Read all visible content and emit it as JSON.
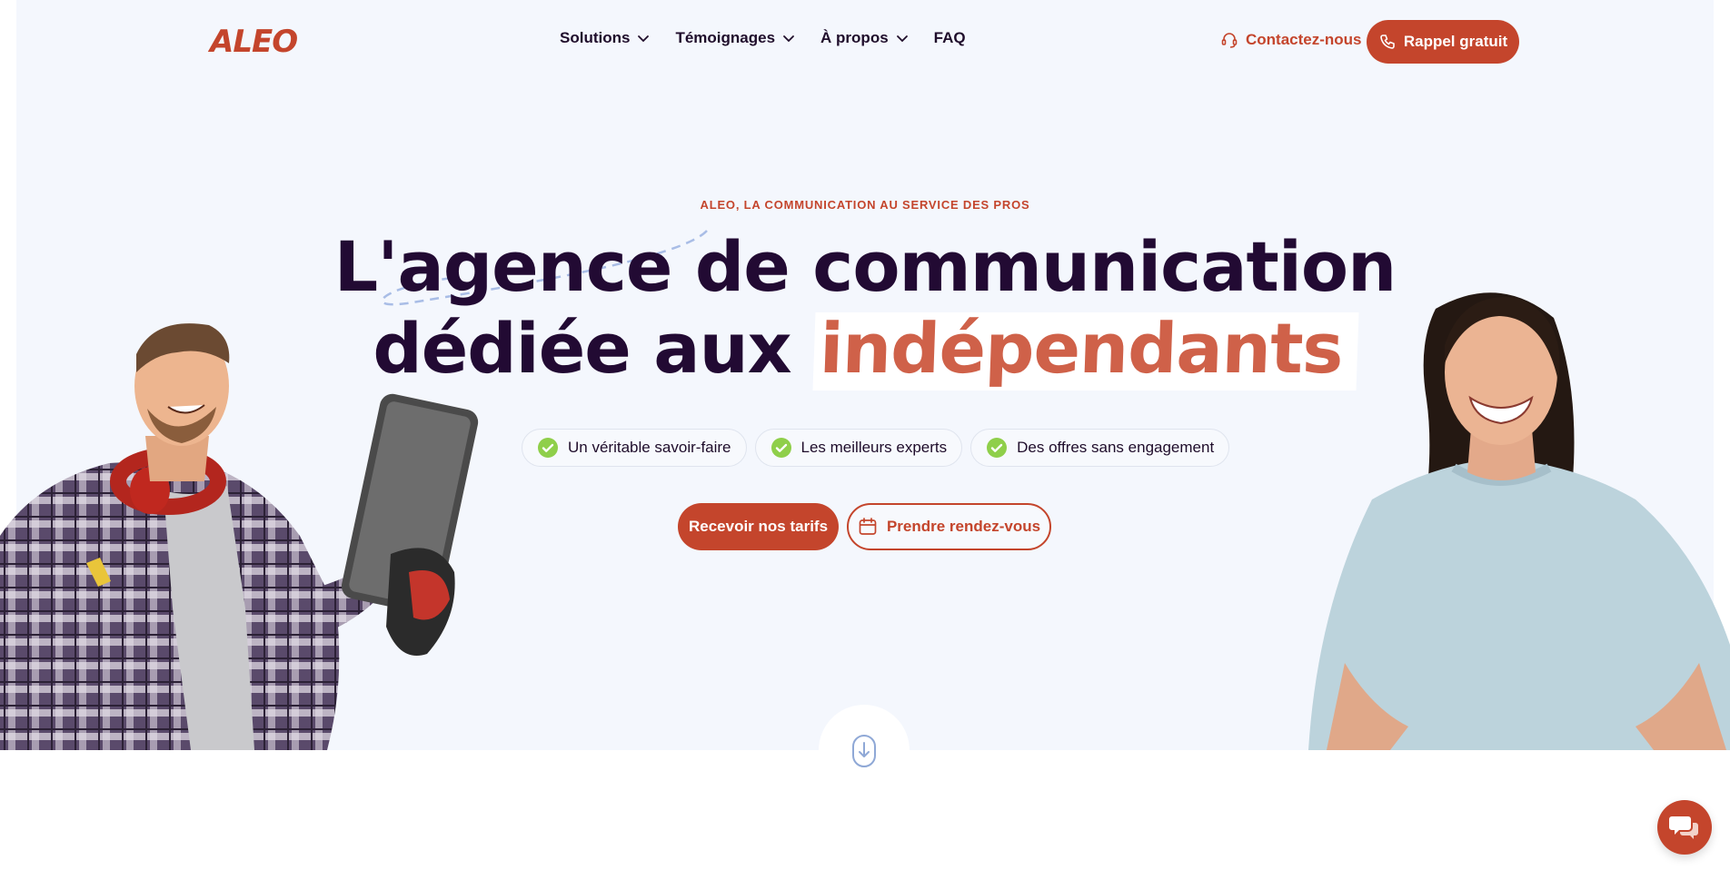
{
  "brand": {
    "logo": "ALEO",
    "accent": "#c4452c",
    "dark": "#220a33"
  },
  "nav": {
    "items": [
      {
        "label": "Solutions",
        "has_dropdown": true
      },
      {
        "label": "Témoignages",
        "has_dropdown": true
      },
      {
        "label": "À propos",
        "has_dropdown": true
      },
      {
        "label": "FAQ",
        "has_dropdown": false
      }
    ],
    "contact_label": "Contactez-nous",
    "callback_label": "Rappel gratuit"
  },
  "hero": {
    "kicker": "ALEO, LA COMMUNICATION AU SERVICE DES PROS",
    "title_line1": "L'agence de communication",
    "title_line2_prefix": "dédiée aux ",
    "title_highlight": "indépendants",
    "pills": [
      {
        "label": "Un véritable savoir-faire",
        "icon": "check-badge-icon"
      },
      {
        "label": "Les meilleurs experts",
        "icon": "check-badge-icon"
      },
      {
        "label": "Des offres sans engagement",
        "icon": "check-badge-icon"
      }
    ],
    "cta_primary": "Recevoir nos tarifs",
    "cta_secondary": "Prendre rendez-vous"
  },
  "icons": {
    "contact": "headset-icon",
    "callback": "phone-icon",
    "calendar": "calendar-icon",
    "scroll": "mouse-scroll-icon",
    "chat": "chat-bubbles-icon"
  }
}
